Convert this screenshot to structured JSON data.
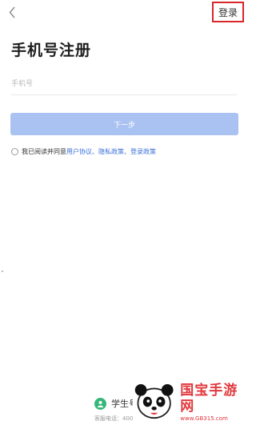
{
  "header": {
    "back_icon": "chevron-left-icon",
    "login_label": "登录",
    "login_border_color": "#d9262c"
  },
  "page": {
    "title": "手机号注册"
  },
  "form": {
    "phone_placeholder": "手机号",
    "phone_value": "",
    "next_label": "下一步",
    "next_color": "#a9c2f1"
  },
  "agreement": {
    "prefix": "我已阅读并同意",
    "user_agreement": "用户协议",
    "sep1": "、",
    "privacy_policy": "隐私政策",
    "sep2": "、",
    "login_policy": "登录政策",
    "link_color": "#3a6fd8"
  },
  "footer": {
    "student_icon": "person-icon",
    "student_label": "学生号",
    "hotline": "客服电话：4001910910（"
  },
  "watermark": {
    "text": "国宝手游网",
    "url": "www.GB315.com",
    "logo": "panda-logo"
  }
}
